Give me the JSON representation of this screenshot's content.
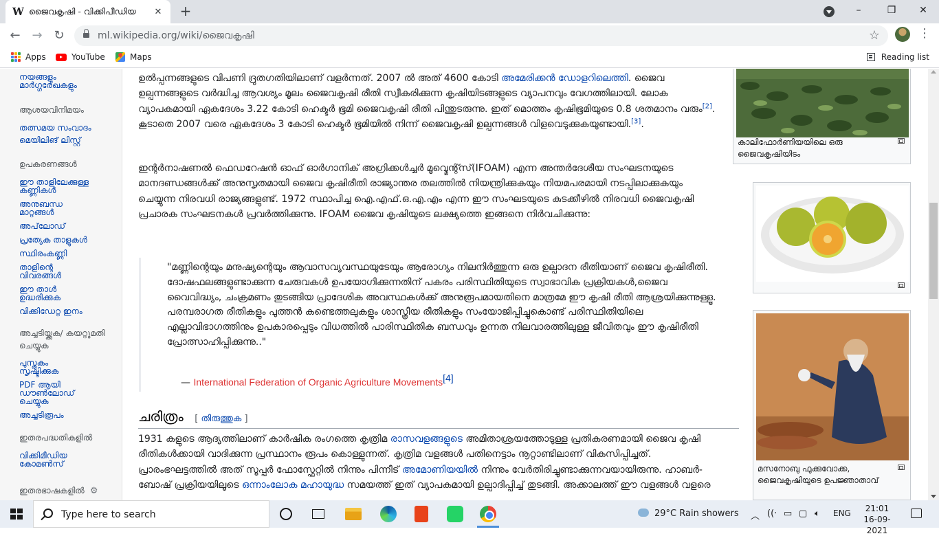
{
  "browser": {
    "tab_title": "ജൈവകൃഷി - വിക്കിപീഡിയ",
    "tab_favicon": "W",
    "url_host": "ml.wikipedia.org",
    "url_path": "/wiki/ജൈവകൃഷി",
    "bookmarks": [
      {
        "label": "Apps",
        "icon": "apps-icon"
      },
      {
        "label": "YouTube",
        "icon": "youtube-icon"
      },
      {
        "label": "Maps",
        "icon": "maps-icon"
      }
    ],
    "reading_list": "Reading list"
  },
  "sidebar": {
    "top_links": [
      "നയങ്ങളും",
      "മാർഗ്ഗരേഖകളും"
    ],
    "groups": [
      {
        "header": "ആശയവിനിമയം",
        "links": [
          "തത്സമയ സംവാദം",
          "മെയിലിങ് ലിസ്റ്റ്"
        ]
      },
      {
        "header": "ഉപകരണങ്ങൾ",
        "links": [
          "ഈ താളിലേക്കുള്ള കണ്ണികൾ",
          "അനുബന്ധ മാറ്റങ്ങൾ",
          "അപ്‌ലോഡ്",
          "പ്രത്യേക താളുകൾ",
          "സ്ഥിരംകണ്ണി",
          "താളിന്റെ വിവരങ്ങൾ",
          "ഈ താൾ ഉദ്ധരിക്കുക",
          "വിക്കിഡേറ്റ ഇനം"
        ]
      },
      {
        "header": "അച്ചടിയ്ക്കുക/ കയറ്റുമതി ചെയ്യുക",
        "links": [
          "പുസ്തകം സൃഷ്ടിക്കുക",
          "PDF ആയി ഡൗൺലോഡ് ചെയ്യുക",
          "അച്ചടിരൂപം"
        ]
      },
      {
        "header": "ഇതരപദ്ധതികളിൽ",
        "links": [
          "വിക്കിമീഡിയ കോമൺസ്"
        ]
      },
      {
        "header": "ഇതരഭാഷകളിൽ",
        "links": []
      }
    ]
  },
  "article": {
    "para1": {
      "a": "ഉൽപ്പന്നങ്ങളുടെ വിപണി ദ്രുതഗതിയിലാണ് വളർന്നത്. 2007 ൽ അത് 4600 കോടി ",
      "link": "അമേരിക്കൻ ഡോളറിലെത്തി",
      "b": ". ജൈവ ഉല്പന്നങ്ങളുടെ വർദ്ധിച്ച ആവശ്യം മൂലം ജൈവകൃഷി രീതി സ്വീകരിക്കുന്ന കൃഷിയിടങ്ങളുടെ വ്യാപനവും വേഗത്തിലായി. ലോക വ്യാപകമായി ഏകദേശം 3.22 കോടി ഹെക്ടർ ഭൂമി ജൈവകൃഷി രീതി പിന്തുടരുന്നു. ഇത് മൊത്തം കൃഷിഭൂമിയുടെ 0.8 ശതമാനം വരും",
      "ref2": "[2]",
      "c": ". കൂടാതെ 2007 വരെ ഏകദേശം 3 കോടി ഹെക്ടർ ഭൂമിയിൽ നിന്ന് ജൈവകൃഷി ഉല്പന്നങ്ങൾ വിളവെടുക്കുകയുണ്ടായി.",
      "ref3": "[3]",
      "d": "."
    },
    "para2": "ഇന്റർനാഷണൽ ഫെഡറേഷൻ ഓഫ് ഓർഗാനിക് അഗ്രിക്കൾച്ചർ മൂവ്മെന്റ്സ്(IFOAM) എന്ന അന്തർദേശീയ സംഘടനയുടെ മാനദണ്ഡങ്ങൾക്ക് അനുസൃതമായി ജൈവ കൃഷിരീതി രാജ്യാന്തര തലത്തിൽ നിയന്ത്രിക്കുകയും നിയമപരമായി നടപ്പിലാക്കുകയും ചെയ്യുന്ന നിരവധി രാജ്യങ്ങളുണ്ട്. 1972 സ്ഥാപിച്ച ഐ.എഫ്.ഒ.എ.എം എന്ന ഈ സംഘടയുടെ കുടക്കീഴിൽ നിരവധി ജൈവകൃഷി പ്രചാരക സംഘടനകൾ പ്രവർത്തിക്കുന്നു. IFOAM ജൈവ കൃഷിയുടെ ലക്ഷ്യത്തെ ഇങ്ങനെ നിർവചിക്കുന്നു:",
    "quote": "\"മണ്ണിന്റെയും മനുഷ്യന്റെയും ആവാസവ്യവസ്ഥയുടേയും ആരോഗ്യം നിലനിർത്തുന്ന ഒരു ഉല്പാദന രീതിയാണ് ജൈവ കൃഷിരീതി. ദോഷഫലങ്ങളുണ്ടാക്കുന്ന ചേരുവകൾ ഉപയോഗിക്കുന്നതിന് പകരം പരിസ്ഥിതിയുടെ സ്വാഭാവിക പ്രക്രിയകൾ,ജൈവ വൈവിദ്ധ്യം, ചംക്രമണം തുടങ്ങിയ പ്രാദേശിക അവസ്ഥകൾക്ക് അനുരൂപമായതിനെ മാത്രമേ ഈ കൃഷി രീതി ആശ്രയിക്കുന്നുള്ളൂ. പരമ്പരാഗത രീതികളും പുത്തൻ കണ്ടെത്തലുകളും ശാസ്ത്രീയ രീതികളും സംയോജിപ്പിച്ചുകൊണ്ട് പരിസ്ഥിതിയിലെ എല്ലാവിഭാഗത്തിനും ഉപകാരപ്പെടും വിധത്തിൽ പാരിസ്ഥിതിക ബന്ധവും ഉന്നത നിലവാരത്തിലുള്ള ജീവിതവും ഈ കൃഷിരീതി പ്രോത്സാഹിപ്പിക്കുന്നു..\"",
    "cite_dash": "— ",
    "cite_link": "International Federation of Organic Agriculture Movements",
    "cite_ref": "[4]",
    "section_title": "ചരിത്രം",
    "edit_open": "[ ",
    "edit_label": "തിരുത്തുക",
    "edit_close": " ]",
    "para3": {
      "a": "1931 കളുടെ ആദ്യത്തിലാണ് കാർഷിക രംഗത്തെ കൃത്രിമ ",
      "link1": "രാസവളങ്ങളുടെ",
      "b": " അമിതാശ്രയത്തോടുള്ള പ്രതികരണമായി ജൈവ കൃഷി രീതികൾക്കായി വാദിക്കുന്ന പ്രസ്ഥാനം രൂപം കൊള്ളുന്നത്. കൃത്രിമ വളങ്ങൾ പതിനെട്ടാം നൂറ്റാണ്ടിലാണ് വികസിപ്പിച്ചത്. പ്രാരംഭഘട്ടത്തിൽ അത് സൂപ്പർ ഫോസ്ഫേറ്റിൽ നിന്നും പിന്നീട് ",
      "link2": "അമോണിയയിൽ",
      "c": " നിന്നും വേർതിരിച്ചുണ്ടാക്കുന്നവയായിരുന്നു. ഹാബർ-ബോഷ് പ്രക്രിയയിലൂടെ ",
      "link3": "ഒന്നാംലോക മഹായുദ്ധ",
      "d": " സമയത്ത് ഇത് വ്യാപകമായി ഉല്പാദിപ്പിച്ച് തുടങ്ങി. അക്കാലത്ത് ഈ വളങ്ങൾ വളരെ"
    }
  },
  "thumbnails": [
    {
      "caption": "കാലിഫോർണിയയിലെ ഒരു ജൈവകൃഷിയിടം"
    },
    {
      "caption": ""
    },
    {
      "caption": "മസനോബു ഫുക്കുവോക്ക, ജൈവകൃഷിയുടെ ഉപജ്ഞാതാവ്"
    }
  ],
  "taskbar": {
    "search_placeholder": "Type here to search",
    "weather": "29°C  Rain showers",
    "language": "ENG",
    "time": "21:01",
    "date": "16-09-2021"
  }
}
